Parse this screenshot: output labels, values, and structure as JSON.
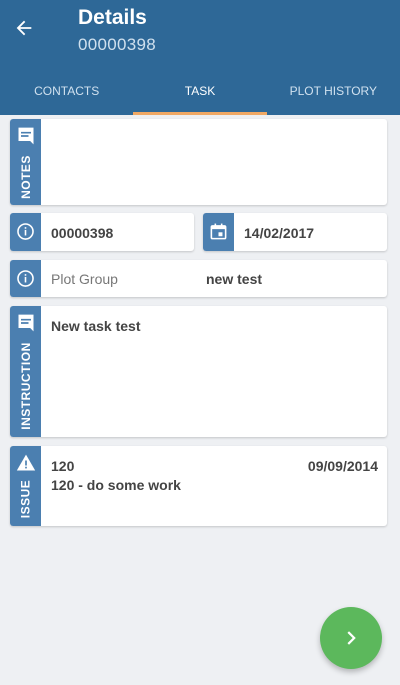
{
  "header": {
    "title": "Details",
    "subtitle": "00000398"
  },
  "tabs": [
    {
      "label": "Contacts",
      "active": false
    },
    {
      "label": "Task",
      "active": true
    },
    {
      "label": "Plot History",
      "active": false
    }
  ],
  "notes": {
    "label": "NOTES",
    "value": ""
  },
  "task": {
    "id": "00000398",
    "date": "14/02/2017"
  },
  "plot_group": {
    "label": "Plot Group",
    "value": "new test"
  },
  "instruction": {
    "label": "INSTRUCTION",
    "value": "New task test"
  },
  "issue": {
    "label": "ISSUE",
    "code": "120",
    "date": "09/09/2014",
    "description": "120 - do some work"
  },
  "colors": {
    "appbar": "#2e6897",
    "strip": "#4b7fb0",
    "tab_indicator": "#f0a864",
    "fab": "#5cb85c"
  },
  "icons": {
    "back": "arrow-left-icon",
    "notes": "comment-icon",
    "info": "info-icon",
    "date": "calendar-icon",
    "issue": "warning-icon",
    "fab": "chevron-right-icon"
  }
}
